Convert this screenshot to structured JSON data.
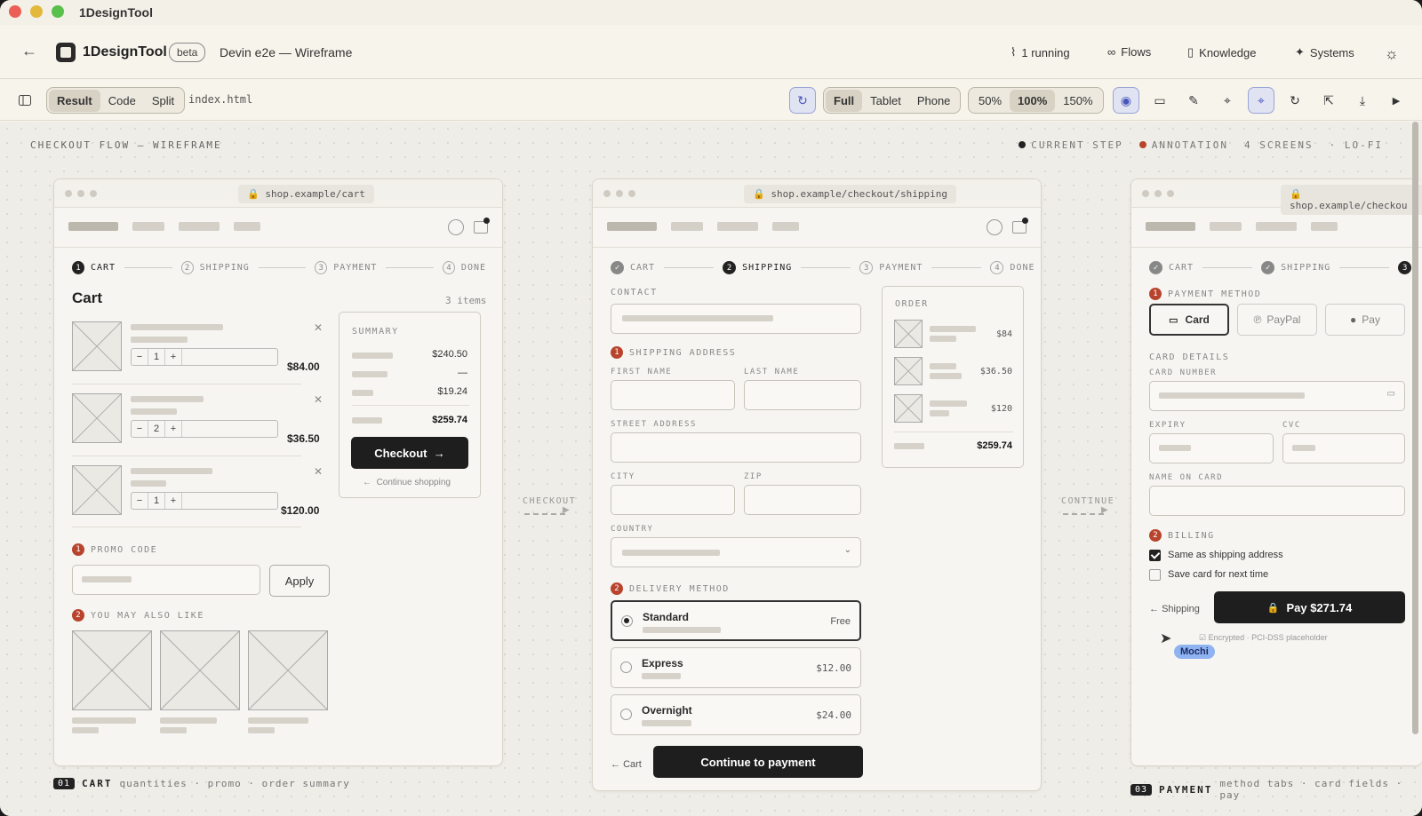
{
  "app_title": "1DesignTool",
  "header": {
    "brand": "1DesignTool",
    "badge": "beta",
    "project": "Devin e2e — Wireframe",
    "nav": [
      {
        "icon": "activity-icon",
        "glyph": "⌇",
        "label": "1 running"
      },
      {
        "icon": "flows-icon",
        "glyph": "∞",
        "label": "Flows"
      },
      {
        "icon": "book-icon",
        "glyph": "▯",
        "label": "Knowledge"
      },
      {
        "icon": "sparkle-icon",
        "glyph": "✦",
        "label": "Systems"
      }
    ]
  },
  "toolbar": {
    "view_modes": [
      "Result",
      "Code",
      "Split"
    ],
    "active_view": "Result",
    "file": "index.html",
    "devices": [
      "Full",
      "Tablet",
      "Phone"
    ],
    "active_device": "Full",
    "zooms": [
      "50%",
      "100%",
      "150%"
    ],
    "active_zoom": "100%"
  },
  "canvas": {
    "title": "CHECKOUT FLOW — WIREFRAME",
    "legend": [
      {
        "label": "CURRENT STEP",
        "color": "#222222"
      },
      {
        "label": "ANNOTATION",
        "color": "#b8442e"
      },
      {
        "label": "4 SCREENS",
        "color": ""
      },
      {
        "label": "LO-FI",
        "color": ""
      }
    ],
    "connectors": [
      "CHECKOUT",
      "CONTINUE"
    ]
  },
  "steps": [
    "CART",
    "SHIPPING",
    "PAYMENT",
    "DONE"
  ],
  "cart": {
    "url": "shop.example/cart",
    "title": "Cart",
    "count": "3 items",
    "items": [
      {
        "qty": "1",
        "price": "$84.00"
      },
      {
        "qty": "2",
        "price": "$36.50"
      },
      {
        "qty": "1",
        "price": "$120.00"
      }
    ],
    "summary_label": "SUMMARY",
    "summary_values": [
      "$240.50",
      "—",
      "$19.24"
    ],
    "summary_total": "$259.74",
    "checkout_label": "Checkout",
    "continue_label": "Continue shopping",
    "promo_label": "PROMO CODE",
    "apply_label": "Apply",
    "also_label": "YOU MAY ALSO LIKE",
    "footer_num": "01",
    "footer_name": "CART",
    "footer_desc": "quantities · promo · order summary"
  },
  "shipping": {
    "url": "shop.example/checkout/shipping",
    "contact": "CONTACT",
    "address": "SHIPPING ADDRESS",
    "first": "FIRST NAME",
    "last": "LAST NAME",
    "street": "STREET ADDRESS",
    "city": "CITY",
    "zip": "ZIP",
    "country": "COUNTRY",
    "delivery": "DELIVERY METHOD",
    "options": [
      {
        "name": "Standard",
        "price": "Free",
        "selected": true
      },
      {
        "name": "Express",
        "price": "$12.00",
        "selected": false
      },
      {
        "name": "Overnight",
        "price": "$24.00",
        "selected": false
      }
    ],
    "order_label": "ORDER",
    "order_prices": [
      "$84",
      "$36.50",
      "$120"
    ],
    "order_total": "$259.74",
    "back_label": "Cart",
    "continue_label": "Continue to payment"
  },
  "payment": {
    "url": "shop.example/checkou",
    "method_label": "PAYMENT METHOD",
    "tabs": [
      "Card",
      "PayPal",
      "Pay"
    ],
    "card_details": "CARD DETAILS",
    "card_number": "CARD NUMBER",
    "expiry": "EXPIRY",
    "cvc": "CVC",
    "name_on_card": "NAME ON CARD",
    "billing": "BILLING",
    "same_as": "Same as shipping address",
    "save_card": "Save card for next time",
    "back_label": "Shipping",
    "pay_label": "Pay $271.74",
    "secure": "Encrypted · PCI-DSS placeholder",
    "cursor_tag": "Mochi",
    "footer_num": "03",
    "footer_name": "PAYMENT",
    "footer_desc": "method tabs · card fields · pay"
  }
}
